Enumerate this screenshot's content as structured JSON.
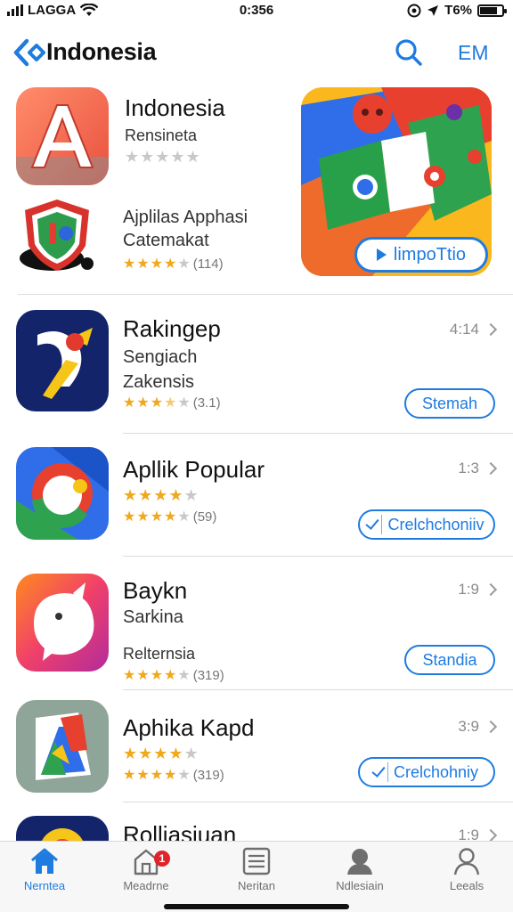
{
  "status_bar": {
    "carrier": "LAGGA",
    "time": "0:356",
    "battery_text": "T6%"
  },
  "nav": {
    "title": "Indonesia",
    "right_label": "EM",
    "accent": "#1e7be0"
  },
  "featured": {
    "app1": {
      "title": "Indonesia",
      "subtitle": "Rensineta",
      "rating": 0
    },
    "app2": {
      "line1": "Ajplilas Apphasi",
      "line2": "Catemakat",
      "rating": 4,
      "count": "(114)"
    },
    "banner_button": "limpoTtio"
  },
  "apps": [
    {
      "title": "Rakingep",
      "line2": "Sengiach",
      "line3": "Zakensis",
      "rating": 3.5,
      "count": "(3.1)",
      "meta": "4:14",
      "button": "Stemah",
      "button_check": false
    },
    {
      "title": "Apllik Popular",
      "line2": "",
      "line3": "",
      "rating": 4,
      "count": "(59)",
      "meta": "1:3",
      "button": "Crelchchoniiv",
      "button_check": true
    },
    {
      "title": "Baykn",
      "line2": "Sarkina",
      "line3": "Relternsia",
      "rating": 4,
      "count": "(319)",
      "meta": "1:9",
      "button": "Standia",
      "button_check": false
    },
    {
      "title": "Aphika Kapd",
      "line2": "",
      "line3": "",
      "rating": 4,
      "count": "(319)",
      "meta": "3:9",
      "button": "Crelchohniy",
      "button_check": true
    },
    {
      "title": "Rolliasiuan",
      "meta": "1:9"
    }
  ],
  "tabs": [
    {
      "label": "Nerntea",
      "icon": "home-icon",
      "active": true
    },
    {
      "label": "Meadrne",
      "icon": "store-icon",
      "badge": "1"
    },
    {
      "label": "Neritan",
      "icon": "list-icon"
    },
    {
      "label": "Ndlesiain",
      "icon": "person-icon"
    },
    {
      "label": "Leeals",
      "icon": "profile-icon"
    }
  ]
}
